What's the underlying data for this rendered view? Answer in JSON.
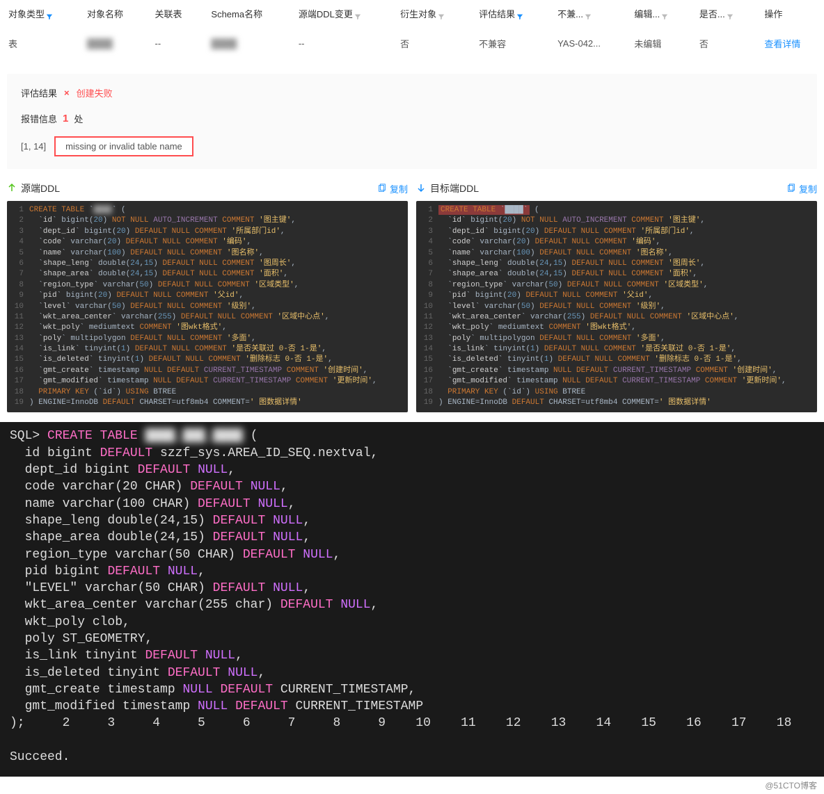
{
  "table": {
    "headers": [
      "对象类型",
      "对象名称",
      "关联表",
      "Schema名称",
      "源端DDL变更",
      "衍生对象",
      "评估结果",
      "不兼...",
      "编辑...",
      "是否...",
      "操作"
    ],
    "row": {
      "type": "表",
      "name": "████",
      "related": "--",
      "schema": "████",
      "ddl_change": "--",
      "derived": "否",
      "eval": "不兼容",
      "incompat": "YAS-042...",
      "edit": "未编辑",
      "whether": "否",
      "action": "查看详情"
    }
  },
  "panel": {
    "eval_label": "评估结果",
    "fail_label": "创建失败",
    "err_label": "报错信息",
    "err_count": "1",
    "err_unit": "处",
    "err_loc": "[1, 14]",
    "err_msg": "missing or invalid table name"
  },
  "ddl": {
    "src_label": "源端DDL",
    "dst_label": "目标端DDL",
    "copy_label": "复制",
    "src_lines": [
      {
        "n": "1",
        "html": "<span class='kw'>CREATE TABLE</span> `<span class='blur-text'>████</span>` ("
      },
      {
        "n": "2",
        "html": "  `<span class='id'>id</span>` bigint(<span class='num'>20</span>) <span class='kw'>NOT NULL</span> <span class='kw2'>AUTO_INCREMENT</span> <span class='kw'>COMMENT</span> <span class='str'>'图主键'</span>,"
      },
      {
        "n": "3",
        "html": "  `<span class='id'>dept_id</span>` bigint(<span class='num'>20</span>) <span class='kw'>DEFAULT NULL</span> <span class='kw'>COMMENT</span> <span class='str'>'所属部门id'</span>,"
      },
      {
        "n": "4",
        "html": "  `<span class='id'>code</span>` varchar(<span class='num'>20</span>) <span class='kw'>DEFAULT NULL</span> <span class='kw'>COMMENT</span> <span class='str'>'编码'</span>,"
      },
      {
        "n": "5",
        "html": "  `<span class='id'>name</span>` varchar(<span class='num'>100</span>) <span class='kw'>DEFAULT NULL</span> <span class='kw'>COMMENT</span> <span class='str'>'图名称'</span>,"
      },
      {
        "n": "6",
        "html": "  `<span class='id'>shape_leng</span>` double(<span class='num'>24</span>,<span class='num'>15</span>) <span class='kw'>DEFAULT NULL</span> <span class='kw'>COMMENT</span> <span class='str'>'图周长'</span>,"
      },
      {
        "n": "7",
        "html": "  `<span class='id'>shape_area</span>` double(<span class='num'>24</span>,<span class='num'>15</span>) <span class='kw'>DEFAULT NULL</span> <span class='kw'>COMMENT</span> <span class='str'>'面积'</span>,"
      },
      {
        "n": "8",
        "html": "  `<span class='id'>region_type</span>` varchar(<span class='num'>50</span>) <span class='kw'>DEFAULT NULL</span> <span class='kw'>COMMENT</span> <span class='str'>'区域类型'</span>,"
      },
      {
        "n": "9",
        "html": "  `<span class='id'>pid</span>` bigint(<span class='num'>20</span>) <span class='kw'>DEFAULT NULL</span> <span class='kw'>COMMENT</span> <span class='str'>'父id'</span>,"
      },
      {
        "n": "10",
        "html": "  `<span class='id'>level</span>` varchar(<span class='num'>50</span>) <span class='kw'>DEFAULT NULL</span> <span class='kw'>COMMENT</span> <span class='str'>'级别'</span>,"
      },
      {
        "n": "11",
        "html": "  `<span class='id'>wkt_area_center</span>` varchar(<span class='num'>255</span>) <span class='kw'>DEFAULT NULL</span> <span class='kw'>COMMENT</span> <span class='str'>'区域中心点'</span>,"
      },
      {
        "n": "12",
        "html": "  `<span class='id'>wkt_poly</span>` mediumtext <span class='kw'>COMMENT</span> <span class='str'>'图wkt格式'</span>,"
      },
      {
        "n": "13",
        "html": "  `<span class='id'>poly</span>` multipolygon <span class='kw'>DEFAULT NULL</span> <span class='kw'>COMMENT</span> <span class='str'>'多面'</span>,"
      },
      {
        "n": "14",
        "html": "  `<span class='id'>is_link</span>` tinyint(<span class='num'>1</span>) <span class='kw'>DEFAULT NULL</span> <span class='kw'>COMMENT</span> <span class='str'>'是否关联过 0-否 1-是'</span>,"
      },
      {
        "n": "15",
        "html": "  `<span class='id'>is_deleted</span>` tinyint(<span class='num'>1</span>) <span class='kw'>DEFAULT NULL</span> <span class='kw'>COMMENT</span> <span class='str'>'删除标志 0-否 1-是'</span>,"
      },
      {
        "n": "16",
        "html": "  `<span class='id'>gmt_create</span>` timestamp <span class='kw'>NULL DEFAULT</span> <span class='kw2'>CURRENT_TIMESTAMP</span> <span class='kw'>COMMENT</span> <span class='str'>'创建时间'</span>,"
      },
      {
        "n": "17",
        "html": "  `<span class='id'>gmt_modified</span>` timestamp <span class='kw'>NULL DEFAULT</span> <span class='kw2'>CURRENT_TIMESTAMP</span> <span class='kw'>COMMENT</span> <span class='str'>'更新时间'</span>,"
      },
      {
        "n": "18",
        "html": "  <span class='kw'>PRIMARY KEY</span> (`id`) <span class='kw'>USING</span> BTREE"
      },
      {
        "n": "19",
        "html": ") ENGINE=InnoDB <span class='kw'>DEFAULT</span> CHARSET=utf8mb4 COMMENT=<span class='str'>' 图数据详情'</span>"
      }
    ],
    "dst_lines": [
      {
        "n": "1",
        "html": "<span class='hl-red'><span class='kw'>CREATE TABLE</span> `████`</span> ("
      },
      {
        "n": "2",
        "html": "  `<span class='id'>id</span>` bigint(<span class='num'>20</span>) <span class='kw'>NOT NULL</span> <span class='kw2'>AUTO_INCREMENT</span> <span class='kw'>COMMENT</span> <span class='str'>'图主键'</span>,"
      },
      {
        "n": "3",
        "html": "  `<span class='id'>dept_id</span>` bigint(<span class='num'>20</span>) <span class='kw'>DEFAULT NULL</span> <span class='kw'>COMMENT</span> <span class='str'>'所属部门id'</span>,"
      },
      {
        "n": "4",
        "html": "  `<span class='id'>code</span>` varchar(<span class='num'>20</span>) <span class='kw'>DEFAULT NULL</span> <span class='kw'>COMMENT</span> <span class='str'>'编码'</span>,"
      },
      {
        "n": "5",
        "html": "  `<span class='id'>name</span>` varchar(<span class='num'>100</span>) <span class='kw'>DEFAULT NULL</span> <span class='kw'>COMMENT</span> <span class='str'>'图名称'</span>,"
      },
      {
        "n": "6",
        "html": "  `<span class='id'>shape_leng</span>` double(<span class='num'>24</span>,<span class='num'>15</span>) <span class='kw'>DEFAULT NULL</span> <span class='kw'>COMMENT</span> <span class='str'>'图周长'</span>,"
      },
      {
        "n": "7",
        "html": "  `<span class='id'>shape_area</span>` double(<span class='num'>24</span>,<span class='num'>15</span>) <span class='kw'>DEFAULT NULL</span> <span class='kw'>COMMENT</span> <span class='str'>'面积'</span>,"
      },
      {
        "n": "8",
        "html": "  `<span class='id'>region_type</span>` varchar(<span class='num'>50</span>) <span class='kw'>DEFAULT NULL</span> <span class='kw'>COMMENT</span> <span class='str'>'区域类型'</span>,"
      },
      {
        "n": "9",
        "html": "  `<span class='id'>pid</span>` bigint(<span class='num'>20</span>) <span class='kw'>DEFAULT NULL</span> <span class='kw'>COMMENT</span> <span class='str'>'父id'</span>,"
      },
      {
        "n": "10",
        "html": "  `<span class='id'>level</span>` varchar(<span class='num'>50</span>) <span class='kw'>DEFAULT NULL</span> <span class='kw'>COMMENT</span> <span class='str'>'级别'</span>,"
      },
      {
        "n": "11",
        "html": "  `<span class='id'>wkt_area_center</span>` varchar(<span class='num'>255</span>) <span class='kw'>DEFAULT NULL</span> <span class='kw'>COMMENT</span> <span class='str'>'区域中心点'</span>,"
      },
      {
        "n": "12",
        "html": "  `<span class='id'>wkt_poly</span>` mediumtext <span class='kw'>COMMENT</span> <span class='str'>'图wkt格式'</span>,"
      },
      {
        "n": "13",
        "html": "  `<span class='id'>poly</span>` multipolygon <span class='kw'>DEFAULT NULL</span> <span class='kw'>COMMENT</span> <span class='str'>'多面'</span>,"
      },
      {
        "n": "14",
        "html": "  `<span class='id'>is_link</span>` tinyint(<span class='num'>1</span>) <span class='kw'>DEFAULT NULL</span> <span class='kw'>COMMENT</span> <span class='str'>'是否关联过 0-否 1-是'</span>,"
      },
      {
        "n": "15",
        "html": "  `<span class='id'>is_deleted</span>` tinyint(<span class='num'>1</span>) <span class='kw'>DEFAULT NULL</span> <span class='kw'>COMMENT</span> <span class='str'>'删除标志 0-否 1-是'</span>,"
      },
      {
        "n": "16",
        "html": "  `<span class='id'>gmt_create</span>` timestamp <span class='kw'>NULL DEFAULT</span> <span class='kw2'>CURRENT_TIMESTAMP</span> <span class='kw'>COMMENT</span> <span class='str'>'创建时间'</span>,"
      },
      {
        "n": "17",
        "html": "  `<span class='id'>gmt_modified</span>` timestamp <span class='kw'>NULL DEFAULT</span> <span class='kw2'>CURRENT_TIMESTAMP</span> <span class='kw'>COMMENT</span> <span class='str'>'更新时间'</span>,"
      },
      {
        "n": "18",
        "html": "  <span class='kw'>PRIMARY KEY</span> (`id`) <span class='kw'>USING</span> BTREE"
      },
      {
        "n": "19",
        "html": ") ENGINE=InnoDB <span class='kw'>DEFAULT</span> CHARSET=utf8mb4 COMMENT=<span class='str'>' 图数据详情'</span>"
      }
    ]
  },
  "terminal": {
    "lines": [
      "SQL> <span class='tkw'>CREATE</span> <span class='tkw'>TABLE</span> <span class='tblur'>████_███_████</span> (",
      "  id bigint <span class='tkw'>DEFAULT</span> szzf_sys.AREA_ID_SEQ.nextval,",
      "  dept_id bigint <span class='tkw'>DEFAULT</span> <span class='tnull'>NULL</span>,",
      "  code varchar(20 CHAR) <span class='tkw'>DEFAULT</span> <span class='tnull'>NULL</span>,",
      "  name varchar(100 CHAR) <span class='tkw'>DEFAULT</span> <span class='tnull'>NULL</span>,",
      "  shape_leng double(24,15) <span class='tkw'>DEFAULT</span> <span class='tnull'>NULL</span>,",
      "  shape_area double(24,15) <span class='tkw'>DEFAULT</span> <span class='tnull'>NULL</span>,",
      "  region_type varchar(50 CHAR) <span class='tkw'>DEFAULT</span> <span class='tnull'>NULL</span>,",
      "  pid bigint <span class='tkw'>DEFAULT</span> <span class='tnull'>NULL</span>,",
      "  \"LEVEL\" varchar(50 CHAR) <span class='tkw'>DEFAULT</span> <span class='tnull'>NULL</span>,",
      "  wkt_area_center varchar(255 char) <span class='tkw'>DEFAULT</span> <span class='tnull'>NULL</span>,",
      "  wkt_poly clob,",
      "  poly ST_GEOMETRY,",
      "  is_link tinyint <span class='tkw'>DEFAULT</span> <span class='tnull'>NULL</span>,",
      "  is_deleted tinyint <span class='tkw'>DEFAULT</span> <span class='tnull'>NULL</span>,",
      "  gmt_create timestamp <span class='tnull'>NULL</span> <span class='tkw'>DEFAULT</span> CURRENT_TIMESTAMP,",
      "  gmt_modified timestamp <span class='tnull'>NULL</span> <span class='tkw'>DEFAULT</span> CURRENT_TIMESTAMP"
    ],
    "tick_row": ");     2     3     4     5     6     7     8     9    10    11    12    13    14    15    16    17    18",
    "succeed": "Succeed."
  },
  "watermark": "@51CTO博客"
}
